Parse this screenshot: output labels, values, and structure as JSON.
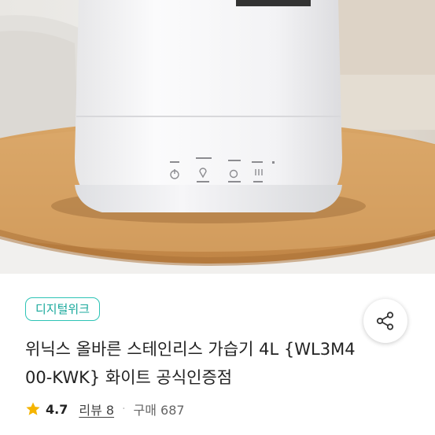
{
  "product": {
    "badge": "디지털위크",
    "title": "위닉스 올바른 스테인리스 가습기 4L {WL3M400-KWK} 화이트 공식인증점",
    "rating": "4.7",
    "review_label": "리뷰 8",
    "separator": "·",
    "purchase_label": "구매 687"
  },
  "icons": {
    "star": "star-icon",
    "share": "share-icon"
  },
  "colors": {
    "badge_accent": "#2ec4b6",
    "star": "#f5b400",
    "text_primary": "#222222",
    "text_secondary": "#666666"
  }
}
